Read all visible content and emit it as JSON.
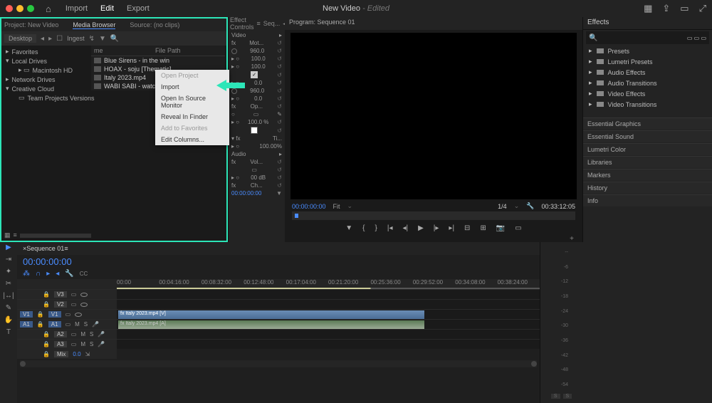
{
  "app": {
    "title": "New Video",
    "edited": " - Edited"
  },
  "menu": {
    "import": "Import",
    "edit": "Edit",
    "export": "Export"
  },
  "project_panel": {
    "tabs": {
      "project": "Project: New Video",
      "media_browser": "Media Browser",
      "source": "Source: (no clips)"
    },
    "location": "Desktop",
    "ingest": "Ingest",
    "tree": {
      "favorites": "Favorites",
      "local": "Local Drives",
      "mac_hd": "Macintosh HD",
      "network": "Network Drives",
      "cc": "Creative Cloud",
      "team": "Team Projects Versions"
    },
    "file_header": {
      "name": "me",
      "path": "File Path"
    },
    "files": [
      "Blue Sirens - in the win",
      "HOAX - soju [Thematic]",
      "Italy 2023.mp4",
      "WABI SABI - watch the"
    ]
  },
  "context_menu": {
    "open_project": "Open Project",
    "import": "Import",
    "open_source": "Open In Source Monitor",
    "reveal": "Reveal In Finder",
    "add_fav": "Add to Favorites",
    "edit_cols": "Edit Columns..."
  },
  "effect_controls": {
    "tab": "Effect Controls",
    "seq": "Seq...",
    "video": "Video",
    "motion": "Mot...",
    "vals": {
      "v1": "960.0",
      "v2": "100.0",
      "v3": "0.0",
      "v4": "960.0",
      "v5": "0.0",
      "v6": "100.0 %"
    },
    "op": "Op...",
    "ti": "Ti...",
    "ti_val": "100.00%",
    "audio": "Audio",
    "vol": "Vol...",
    "db": "00 dB",
    "ch": "Ch...",
    "timecode": "00:00:00:00"
  },
  "program": {
    "title": "Program: Sequence 01",
    "tc_left": "00:00:00:00",
    "fit": "Fit",
    "scale": "1/4",
    "tc_right": "00:33:12:05"
  },
  "effects": {
    "title": "Effects",
    "search_ph": "",
    "folders": [
      "Presets",
      "Lumetri Presets",
      "Audio Effects",
      "Audio Transitions",
      "Video Effects",
      "Video Transitions"
    ],
    "panels": [
      "Essential Graphics",
      "Essential Sound",
      "Lumetri Color",
      "Libraries",
      "Markers",
      "History",
      "Info"
    ]
  },
  "timeline": {
    "seq": "Sequence 01",
    "tc": "00:00:00:00",
    "ruler": [
      "00:00",
      "00:04:16:00",
      "00:08:32:00",
      "00:12:48:00",
      "00:17:04:00",
      "00:21:20:00",
      "00:25:36:00",
      "00:29:52:00",
      "00:34:08:00",
      "00:38:24:00"
    ],
    "tracks": {
      "v3": "V3",
      "v2": "V2",
      "v1": "V1",
      "a1": "A1",
      "a2": "A2",
      "a3": "A3",
      "mix": "Mix",
      "mix_val": "0.0",
      "m": "M",
      "s": "S"
    },
    "clips": {
      "v": "Italy 2023.mp4 [V]",
      "a": "Italy 2023.mp4 [A]"
    }
  },
  "meter": {
    "scale": [
      "--",
      "-6",
      "-12",
      "-18",
      "-24",
      "-30",
      "-36",
      "-42",
      "-48",
      "-54"
    ],
    "s": "S"
  }
}
